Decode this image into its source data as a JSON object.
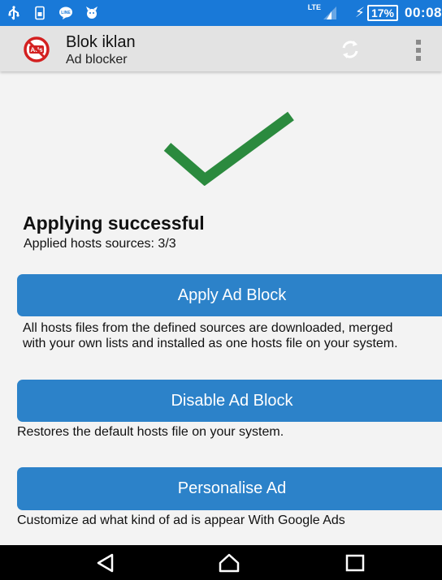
{
  "status_bar": {
    "network": "LTE",
    "battery_percent": "17%",
    "time": "00:08",
    "left_icons": [
      "usb-icon",
      "sim-icon",
      "line-app-icon",
      "notification-app-icon"
    ],
    "color": "#1979d8"
  },
  "action_bar": {
    "title": "Blok iklan",
    "subtitle": "Ad blocker",
    "logo_icon": "no-ads-logo-icon",
    "actions": [
      "refresh-icon",
      "overflow-menu-icon"
    ]
  },
  "status": {
    "icon": "checkmark-icon",
    "title": "Applying successful",
    "subtitle": "Applied hosts sources: 3/3",
    "check_color": "#2b8a3e"
  },
  "actions": {
    "apply": {
      "label": "Apply Ad Block",
      "description": "All hosts files from the defined sources are downloaded, merged with your own lists and installed as one hosts file on your system."
    },
    "disable": {
      "label": "Disable Ad Block",
      "description": "Restores the default hosts file on your system."
    },
    "personalise": {
      "label": "Personalise Ad",
      "description": "Customize ad what kind of ad is appear With Google Ads"
    },
    "button_color": "#2c82c9"
  },
  "nav_bar": {
    "buttons": [
      "back-icon",
      "home-icon",
      "recent-apps-icon"
    ]
  }
}
